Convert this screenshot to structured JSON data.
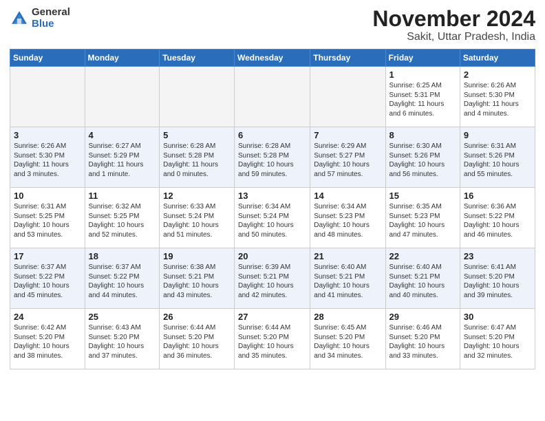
{
  "header": {
    "logo_general": "General",
    "logo_blue": "Blue",
    "title": "November 2024",
    "location": "Sakit, Uttar Pradesh, India"
  },
  "weekdays": [
    "Sunday",
    "Monday",
    "Tuesday",
    "Wednesday",
    "Thursday",
    "Friday",
    "Saturday"
  ],
  "weeks": [
    [
      {
        "day": "",
        "info": ""
      },
      {
        "day": "",
        "info": ""
      },
      {
        "day": "",
        "info": ""
      },
      {
        "day": "",
        "info": ""
      },
      {
        "day": "",
        "info": ""
      },
      {
        "day": "1",
        "info": "Sunrise: 6:25 AM\nSunset: 5:31 PM\nDaylight: 11 hours and 6 minutes."
      },
      {
        "day": "2",
        "info": "Sunrise: 6:26 AM\nSunset: 5:30 PM\nDaylight: 11 hours and 4 minutes."
      }
    ],
    [
      {
        "day": "3",
        "info": "Sunrise: 6:26 AM\nSunset: 5:30 PM\nDaylight: 11 hours and 3 minutes."
      },
      {
        "day": "4",
        "info": "Sunrise: 6:27 AM\nSunset: 5:29 PM\nDaylight: 11 hours and 1 minute."
      },
      {
        "day": "5",
        "info": "Sunrise: 6:28 AM\nSunset: 5:28 PM\nDaylight: 11 hours and 0 minutes."
      },
      {
        "day": "6",
        "info": "Sunrise: 6:28 AM\nSunset: 5:28 PM\nDaylight: 10 hours and 59 minutes."
      },
      {
        "day": "7",
        "info": "Sunrise: 6:29 AM\nSunset: 5:27 PM\nDaylight: 10 hours and 57 minutes."
      },
      {
        "day": "8",
        "info": "Sunrise: 6:30 AM\nSunset: 5:26 PM\nDaylight: 10 hours and 56 minutes."
      },
      {
        "day": "9",
        "info": "Sunrise: 6:31 AM\nSunset: 5:26 PM\nDaylight: 10 hours and 55 minutes."
      }
    ],
    [
      {
        "day": "10",
        "info": "Sunrise: 6:31 AM\nSunset: 5:25 PM\nDaylight: 10 hours and 53 minutes."
      },
      {
        "day": "11",
        "info": "Sunrise: 6:32 AM\nSunset: 5:25 PM\nDaylight: 10 hours and 52 minutes."
      },
      {
        "day": "12",
        "info": "Sunrise: 6:33 AM\nSunset: 5:24 PM\nDaylight: 10 hours and 51 minutes."
      },
      {
        "day": "13",
        "info": "Sunrise: 6:34 AM\nSunset: 5:24 PM\nDaylight: 10 hours and 50 minutes."
      },
      {
        "day": "14",
        "info": "Sunrise: 6:34 AM\nSunset: 5:23 PM\nDaylight: 10 hours and 48 minutes."
      },
      {
        "day": "15",
        "info": "Sunrise: 6:35 AM\nSunset: 5:23 PM\nDaylight: 10 hours and 47 minutes."
      },
      {
        "day": "16",
        "info": "Sunrise: 6:36 AM\nSunset: 5:22 PM\nDaylight: 10 hours and 46 minutes."
      }
    ],
    [
      {
        "day": "17",
        "info": "Sunrise: 6:37 AM\nSunset: 5:22 PM\nDaylight: 10 hours and 45 minutes."
      },
      {
        "day": "18",
        "info": "Sunrise: 6:37 AM\nSunset: 5:22 PM\nDaylight: 10 hours and 44 minutes."
      },
      {
        "day": "19",
        "info": "Sunrise: 6:38 AM\nSunset: 5:21 PM\nDaylight: 10 hours and 43 minutes."
      },
      {
        "day": "20",
        "info": "Sunrise: 6:39 AM\nSunset: 5:21 PM\nDaylight: 10 hours and 42 minutes."
      },
      {
        "day": "21",
        "info": "Sunrise: 6:40 AM\nSunset: 5:21 PM\nDaylight: 10 hours and 41 minutes."
      },
      {
        "day": "22",
        "info": "Sunrise: 6:40 AM\nSunset: 5:21 PM\nDaylight: 10 hours and 40 minutes."
      },
      {
        "day": "23",
        "info": "Sunrise: 6:41 AM\nSunset: 5:20 PM\nDaylight: 10 hours and 39 minutes."
      }
    ],
    [
      {
        "day": "24",
        "info": "Sunrise: 6:42 AM\nSunset: 5:20 PM\nDaylight: 10 hours and 38 minutes."
      },
      {
        "day": "25",
        "info": "Sunrise: 6:43 AM\nSunset: 5:20 PM\nDaylight: 10 hours and 37 minutes."
      },
      {
        "day": "26",
        "info": "Sunrise: 6:44 AM\nSunset: 5:20 PM\nDaylight: 10 hours and 36 minutes."
      },
      {
        "day": "27",
        "info": "Sunrise: 6:44 AM\nSunset: 5:20 PM\nDaylight: 10 hours and 35 minutes."
      },
      {
        "day": "28",
        "info": "Sunrise: 6:45 AM\nSunset: 5:20 PM\nDaylight: 10 hours and 34 minutes."
      },
      {
        "day": "29",
        "info": "Sunrise: 6:46 AM\nSunset: 5:20 PM\nDaylight: 10 hours and 33 minutes."
      },
      {
        "day": "30",
        "info": "Sunrise: 6:47 AM\nSunset: 5:20 PM\nDaylight: 10 hours and 32 minutes."
      }
    ]
  ]
}
